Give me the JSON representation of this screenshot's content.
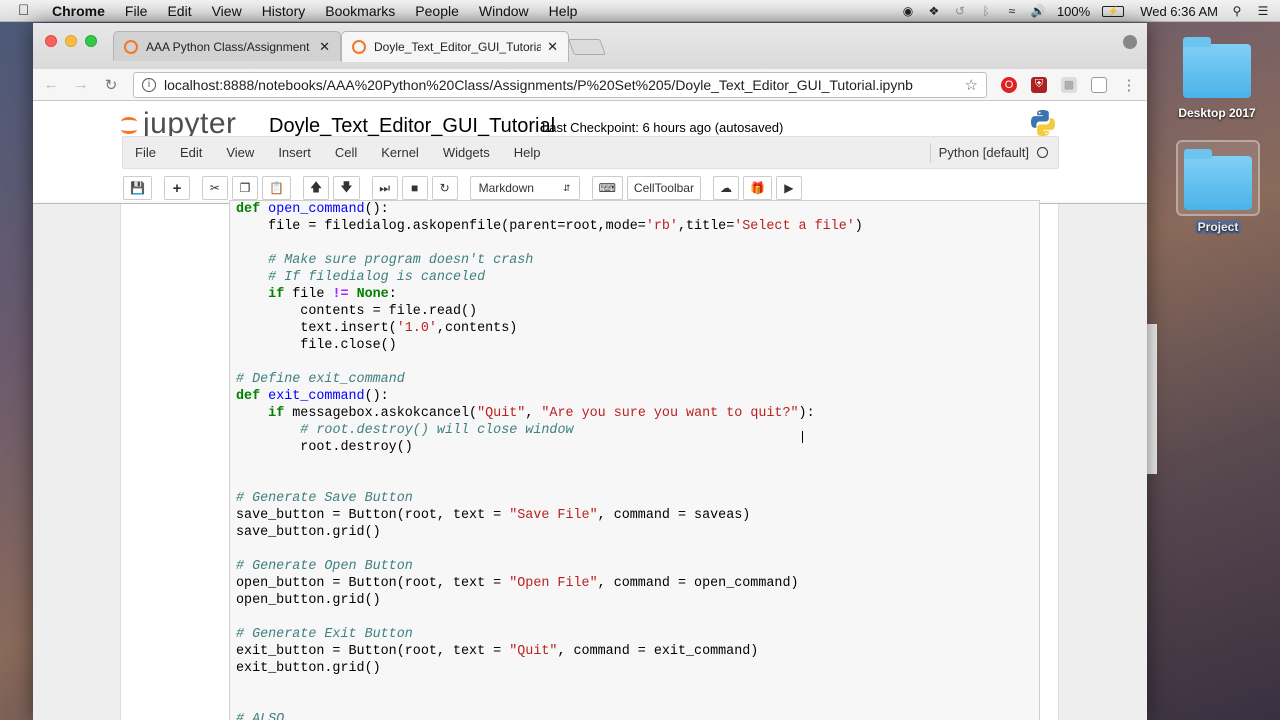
{
  "menubar": {
    "app": "Chrome",
    "items": [
      "File",
      "Edit",
      "View",
      "History",
      "Bookmarks",
      "People",
      "Window",
      "Help"
    ],
    "battery": "100%",
    "clock": "Wed 6:36 AM"
  },
  "desktop": {
    "folders": [
      {
        "label": "Desktop 2017"
      },
      {
        "label": "Project"
      }
    ]
  },
  "browser": {
    "tabs": [
      {
        "label": "AAA Python Class/Assignment"
      },
      {
        "label": "Doyle_Text_Editor_GUI_Tutoria"
      }
    ],
    "url": "localhost:8888/notebooks/AAA%20Python%20Class/Assignments/P%20Set%205/Doyle_Text_Editor_GUI_Tutorial.ipynb"
  },
  "jupyter": {
    "logo_text": "jupyter",
    "notebook_title": "Doyle_Text_Editor_GUI_Tutorial",
    "checkpoint": "Last Checkpoint: 6 hours ago (autosaved)",
    "menu": [
      "File",
      "Edit",
      "View",
      "Insert",
      "Cell",
      "Kernel",
      "Widgets",
      "Help"
    ],
    "kernel_name": "Python [default]",
    "cell_type": "Markdown",
    "celltoolbar_label": "CellToolbar"
  }
}
